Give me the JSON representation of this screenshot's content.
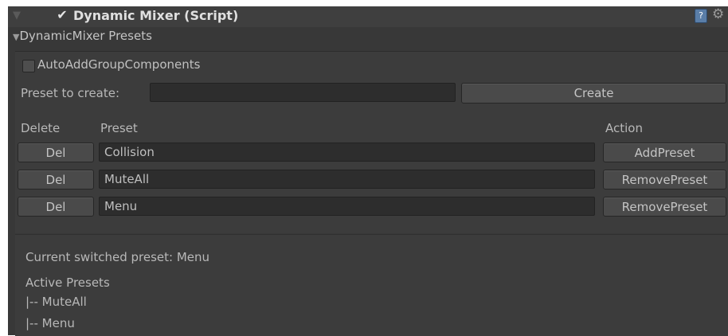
{
  "component": {
    "title": "Dynamic Mixer (Script)",
    "enabled": true,
    "help_icon": "help-icon",
    "settings_icon": "gear-icon"
  },
  "foldout": {
    "label": "DynamicMixer Presets",
    "expanded": true
  },
  "options": {
    "auto_add_label": "AutoAddGroupComponents",
    "auto_add_checked": false
  },
  "create": {
    "label": "Preset to create:",
    "value": "",
    "button_label": "Create"
  },
  "table": {
    "headers": {
      "delete": "Delete",
      "preset": "Preset",
      "action": "Action"
    },
    "rows": [
      {
        "delete_label": "Del",
        "preset": "Collision",
        "action": "AddPreset"
      },
      {
        "delete_label": "Del",
        "preset": "MuteAll",
        "action": "RemovePreset"
      },
      {
        "delete_label": "Del",
        "preset": "Menu",
        "action": "RemovePreset"
      }
    ]
  },
  "status": {
    "current": "Current switched preset: Menu",
    "active_header": "Active Presets",
    "active_items": [
      "|-- MuteAll",
      "|-- Menu"
    ]
  },
  "colors": {
    "panel_bg": "#383838",
    "field_bg": "#2d2d2d",
    "button_bg": "#4a4a4a",
    "text": "#b4b4b4"
  }
}
